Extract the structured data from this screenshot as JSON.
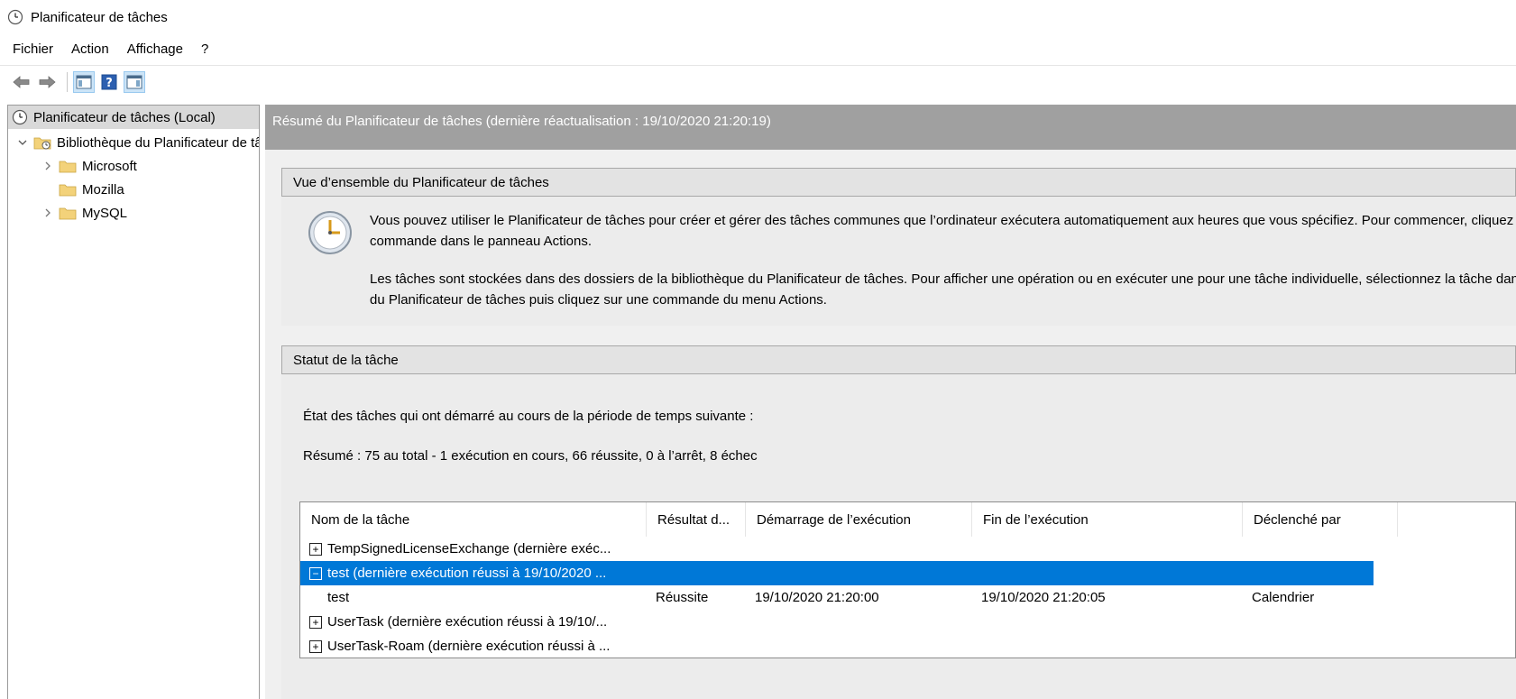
{
  "window": {
    "title": "Planificateur de tâches"
  },
  "menu": [
    "Fichier",
    "Action",
    "Affichage",
    "?"
  ],
  "toolbar": [
    "back-arrow-icon",
    "forward-arrow-icon",
    "show-hide-console-tree-icon",
    "help-icon",
    "show-hide-action-pane-icon"
  ],
  "tree": {
    "root": "Planificateur de tâches (Local)",
    "library": "Bibliothèque du Planificateur de tâches",
    "folders": [
      "Microsoft",
      "Mozilla",
      "MySQL"
    ]
  },
  "summary_header": "Résumé du Planificateur de tâches (dernière réactualisation : 19/10/2020 21:20:19)",
  "overview": {
    "title": "Vue d’ensemble du Planificateur de tâches",
    "para1_line1": "Vous pouvez utiliser le Planificateur de tâches pour créer et gérer des tâches communes que l’ordinateur exécutera automatiquement aux heures que vous spécifiez. Pour commencer, cliquez sur une",
    "para1_line2": "commande dans le panneau Actions.",
    "para2_line1": "Les tâches sont stockées dans des dossiers de la bibliothèque du Planificateur de tâches. Pour afficher une opération ou en exécuter une pour une tâche individuelle, sélectionnez la tâche dans la bibliothèque",
    "para2_line2": "du Planificateur de tâches puis cliquez sur une commande du menu Actions."
  },
  "status": {
    "title": "Statut de la tâche",
    "period_label": "État des tâches qui ont démarré au cours de la période de temps suivante :",
    "summary": "Résumé : 75 au total - 1 exécution en cours, 66 réussite, 0 à l’arrêt, 8 échec"
  },
  "table": {
    "columns": [
      "Nom de la tâche",
      "Résultat d...",
      "Démarrage de l’exécution",
      "Fin de l’exécution",
      "Déclenché par"
    ],
    "rows": [
      {
        "toggle": "+",
        "name": "TempSignedLicenseExchange (dernière exéc...",
        "result": "",
        "start": "",
        "end": "",
        "trigger": ""
      },
      {
        "toggle": "−",
        "name": "test (dernière exécution réussi à 19/10/2020 ...",
        "result": "",
        "start": "",
        "end": "",
        "trigger": "",
        "selected": true
      },
      {
        "toggle": "",
        "name": "test",
        "result": "Réussite",
        "start": "19/10/2020 21:20:00",
        "end": "19/10/2020 21:20:05",
        "trigger": "Calendrier"
      },
      {
        "toggle": "+",
        "name": "UserTask (dernière exécution réussi à 19/10/...",
        "result": "",
        "start": "",
        "end": "",
        "trigger": ""
      },
      {
        "toggle": "+",
        "name": "UserTask-Roam (dernière exécution réussi à ...",
        "result": "",
        "start": "",
        "end": "",
        "trigger": ""
      }
    ]
  }
}
